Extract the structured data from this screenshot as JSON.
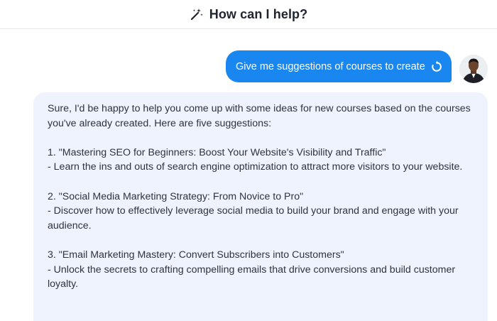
{
  "header": {
    "icon": "magic-wand-icon",
    "title": "How can I help?"
  },
  "colors": {
    "accent": "#1a86f0",
    "assistant_bubble": "#eef3fd",
    "text": "#2d3340"
  },
  "user_message": {
    "text": "Give me suggestions of courses to create",
    "action_icon": "regenerate-icon"
  },
  "assistant_message": {
    "intro": "Sure, I'd be happy to help you come up with some ideas for new courses based on the courses you've already created. Here are five suggestions:",
    "items": [
      {
        "title": "1. \"Mastering SEO for Beginners: Boost Your Website's Visibility and Traffic\"",
        "desc": "- Learn the ins and outs of search engine optimization to attract more visitors to your website."
      },
      {
        "title": "2. \"Social Media Marketing Strategy: From Novice to Pro\"",
        "desc": "- Discover how to effectively leverage social media to build your brand and engage with your audience."
      },
      {
        "title": "3. \"Email Marketing Mastery: Convert Subscribers into Customers\"",
        "desc": "- Unlock the secrets to crafting compelling emails that drive conversions and build customer loyalty."
      }
    ]
  }
}
